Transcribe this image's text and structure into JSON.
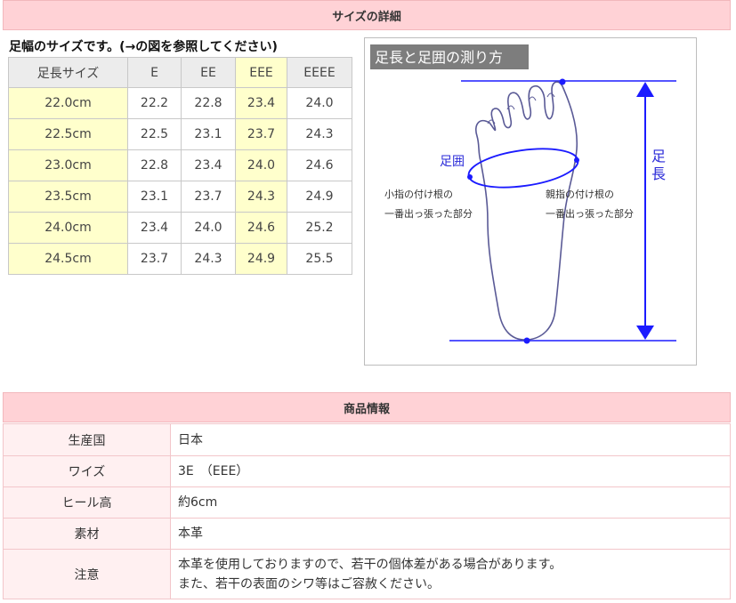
{
  "size_section": {
    "title": "サイズの詳細",
    "caption": "足幅のサイズです。(→の図を参照してください)",
    "headers": [
      "足長サイズ",
      "E",
      "EE",
      "EEE",
      "EEEE"
    ],
    "rows": [
      [
        "22.0cm",
        "22.2",
        "22.8",
        "23.4",
        "24.0"
      ],
      [
        "22.5cm",
        "22.5",
        "23.1",
        "23.7",
        "24.3"
      ],
      [
        "23.0cm",
        "22.8",
        "23.4",
        "24.0",
        "24.6"
      ],
      [
        "23.5cm",
        "23.1",
        "23.7",
        "24.3",
        "24.9"
      ],
      [
        "24.0cm",
        "23.4",
        "24.0",
        "24.6",
        "25.2"
      ],
      [
        "24.5cm",
        "23.7",
        "24.3",
        "24.9",
        "25.5"
      ]
    ]
  },
  "diagram": {
    "title": "足長と足囲の測り方",
    "girth_label": "足囲",
    "length_label_1": "足",
    "length_label_2": "長",
    "left_note_1": "小指の付け根の",
    "left_note_2": "一番出っ張った部分",
    "right_note_1": "親指の付け根の",
    "right_note_2": "一番出っ張った部分",
    "colors": {
      "measure": "#1b1bff",
      "girth_label": "#2a2ad8",
      "foot_outline": "#5a5a96",
      "title_bg": "#7d7d7d"
    }
  },
  "info_section": {
    "title": "商品情報",
    "rows": [
      {
        "label": "生産国",
        "value": "日本"
      },
      {
        "label": "ワイズ",
        "value": "3E　（EEE）"
      },
      {
        "label": "ヒール高",
        "value": "約6cm"
      },
      {
        "label": "素材",
        "value": "本革"
      },
      {
        "label": "注意",
        "value_line1": "本革を使用しておりますので、若干の個体差がある場合があります。",
        "value_line2": "また、若干の表面のシワ等はご容赦ください。"
      }
    ]
  },
  "colors": {
    "header_bg": "#ffd2d6",
    "highlight": "#ffffcc",
    "label_bg": "#fff0f1"
  }
}
